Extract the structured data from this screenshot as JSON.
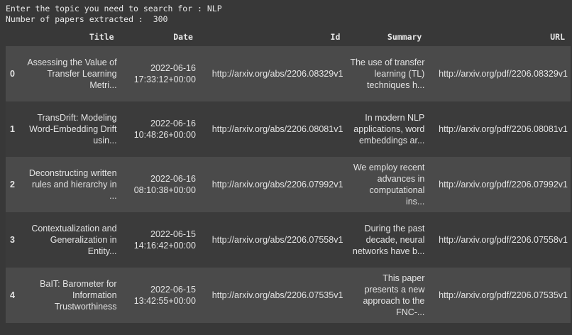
{
  "console": {
    "prompt_line": "Enter the topic you need to search for : NLP",
    "count_line": "Number of papers extracted :  300"
  },
  "table": {
    "columns": [
      "",
      "Title",
      "Date",
      "Id",
      "Summary",
      "URL"
    ],
    "rows": [
      {
        "index": "0",
        "title": "Assessing the Value of Transfer Learning Metri...",
        "date": "2022-06-16 17:33:12+00:00",
        "id": "http://arxiv.org/abs/2206.08329v1",
        "summary": "The use of transfer learning (TL) techniques h...",
        "url": "http://arxiv.org/pdf/2206.08329v1"
      },
      {
        "index": "1",
        "title": "TransDrift: Modeling Word-Embedding Drift usin...",
        "date": "2022-06-16 10:48:26+00:00",
        "id": "http://arxiv.org/abs/2206.08081v1",
        "summary": "In modern NLP applications, word embeddings ar...",
        "url": "http://arxiv.org/pdf/2206.08081v1"
      },
      {
        "index": "2",
        "title": "Deconstructing written rules and hierarchy in ...",
        "date": "2022-06-16 08:10:38+00:00",
        "id": "http://arxiv.org/abs/2206.07992v1",
        "summary": "We employ recent advances in computational ins...",
        "url": "http://arxiv.org/pdf/2206.07992v1"
      },
      {
        "index": "3",
        "title": "Contextualization and Generalization in Entity...",
        "date": "2022-06-15 14:16:42+00:00",
        "id": "http://arxiv.org/abs/2206.07558v1",
        "summary": "During the past decade, neural networks have b...",
        "url": "http://arxiv.org/pdf/2206.07558v1"
      },
      {
        "index": "4",
        "title": "BaIT: Barometer for Information Trustworthiness",
        "date": "2022-06-15 13:42:55+00:00",
        "id": "http://arxiv.org/abs/2206.07535v1",
        "summary": "This paper presents a new approach to the FNC-...",
        "url": "http://arxiv.org/pdf/2206.07535v1"
      }
    ]
  }
}
